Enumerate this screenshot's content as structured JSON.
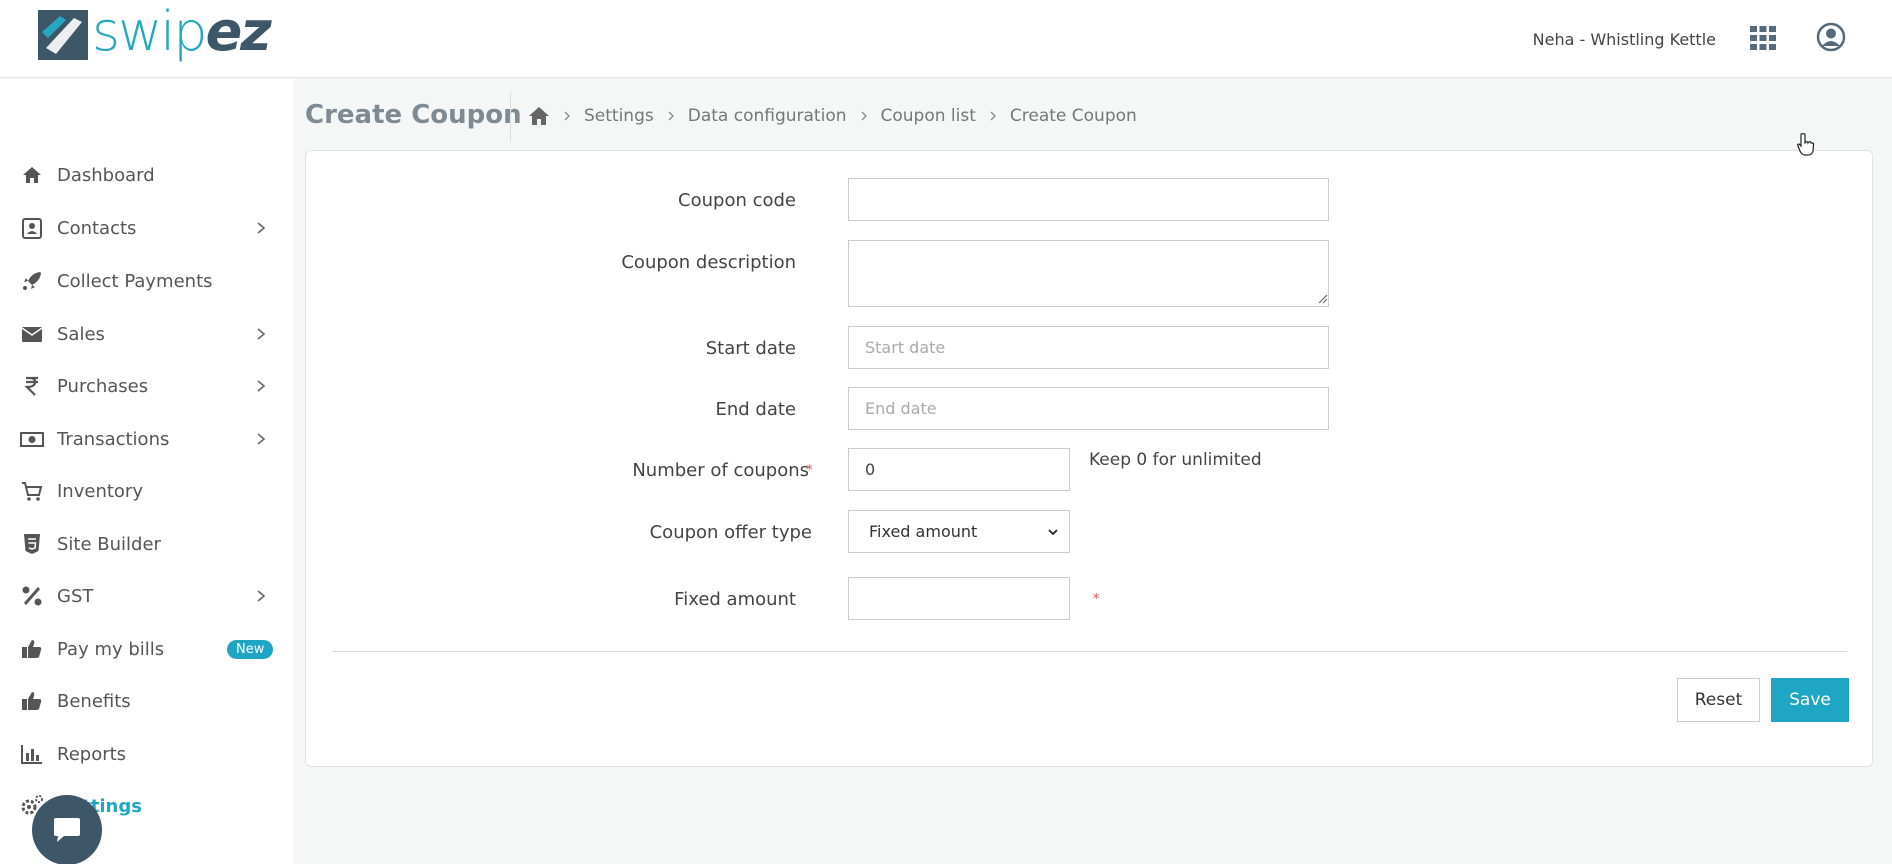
{
  "header": {
    "logo_text_part1": "swip",
    "logo_text_part2": "ez",
    "user_name": "Neha - Whistling Kettle",
    "apps_icon": "grid-icon",
    "profile_icon": "user-circle-icon"
  },
  "sidebar": {
    "items": [
      {
        "label": "Dashboard",
        "icon": "home-icon",
        "has_chevron": false
      },
      {
        "label": "Contacts",
        "icon": "contact-book-icon",
        "has_chevron": true
      },
      {
        "label": "Collect Payments",
        "icon": "rocket-icon",
        "has_chevron": false
      },
      {
        "label": "Sales",
        "icon": "envelope-icon",
        "has_chevron": true
      },
      {
        "label": "Purchases",
        "icon": "rupee-icon",
        "has_chevron": true
      },
      {
        "label": "Transactions",
        "icon": "money-icon",
        "has_chevron": true
      },
      {
        "label": "Inventory",
        "icon": "cart-icon",
        "has_chevron": false
      },
      {
        "label": "Site Builder",
        "icon": "html5-icon",
        "has_chevron": false
      },
      {
        "label": "GST",
        "icon": "percent-icon",
        "has_chevron": true
      },
      {
        "label": "Pay my bills",
        "icon": "thumbs-up-icon",
        "has_chevron": false,
        "badge": "New"
      },
      {
        "label": "Benefits",
        "icon": "thumbs-up-icon",
        "has_chevron": false
      },
      {
        "label": "Reports",
        "icon": "bar-chart-icon",
        "has_chevron": false
      },
      {
        "label": "Settings",
        "icon": "gears-icon",
        "has_chevron": false,
        "active": true
      }
    ],
    "chat_icon": "chat-icon"
  },
  "page": {
    "title": "Create Coupon",
    "breadcrumb": [
      "Settings",
      "Data configuration",
      "Coupon list",
      "Create Coupon"
    ]
  },
  "form": {
    "coupon_code": {
      "label": "Coupon code",
      "required": "*",
      "value": ""
    },
    "coupon_description": {
      "label": "Coupon description",
      "required": "*",
      "value": ""
    },
    "start_date": {
      "label": "Start date",
      "required": "*",
      "placeholder": "Start date"
    },
    "end_date": {
      "label": "End date",
      "required": "*",
      "placeholder": "End date"
    },
    "number_of_coupons": {
      "label": "Number of coupons",
      "required": "*",
      "value": "0",
      "hint": "Keep 0 for unlimited"
    },
    "coupon_offer_type": {
      "label": "Coupon offer type",
      "selected": "Fixed amount"
    },
    "fixed_amount": {
      "label": "Fixed amount",
      "required": "*",
      "value": ""
    }
  },
  "actions": {
    "reset_label": "Reset",
    "save_label": "Save"
  },
  "colors": {
    "accent": "#1fa6c4",
    "brand_dark": "#3d5668",
    "required": "#e04a4a"
  }
}
